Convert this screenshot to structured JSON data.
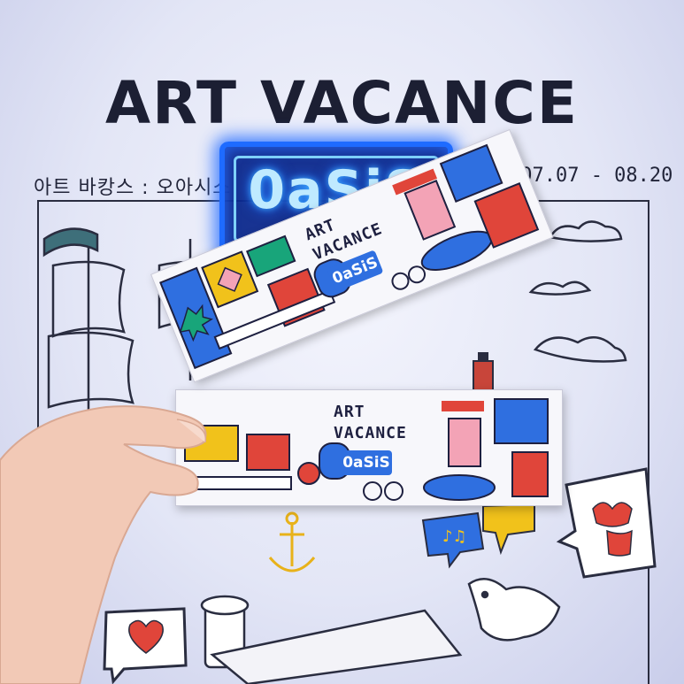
{
  "wall": {
    "title": "ART VACANCE",
    "subtitle_ko": "아트 바캉스 : 오아시스",
    "dates": "2023.07.07 - 08.20",
    "neon_sign": "0aSiS"
  },
  "ticket": {
    "line1": "ART",
    "line2": "VACANCE",
    "badge": "0aSiS"
  },
  "colors": {
    "neon_blue": "#1e6bff",
    "ticket_blue": "#2f6fe0",
    "accent_red": "#e0453a",
    "accent_pink": "#f3a3b6",
    "accent_yellow": "#f1c21b"
  }
}
